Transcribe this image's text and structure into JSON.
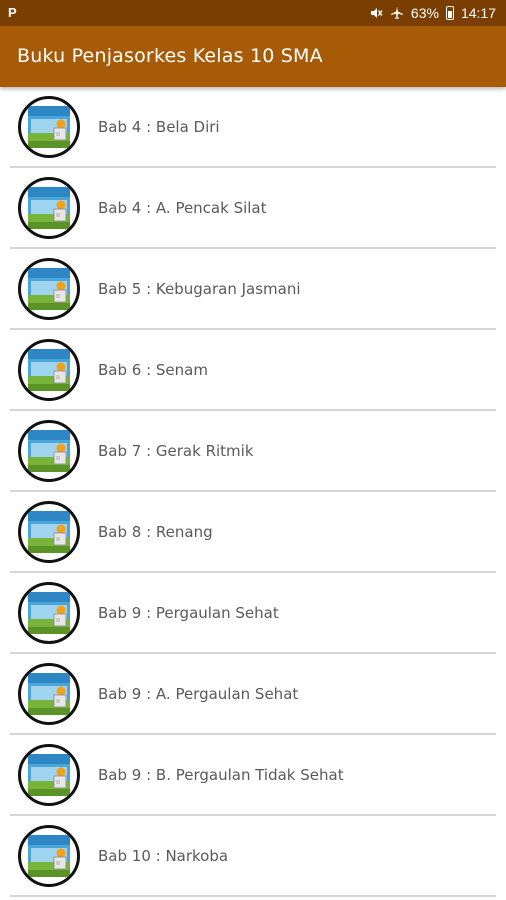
{
  "status_bar": {
    "battery": "63%",
    "time": "14:17"
  },
  "app_bar": {
    "title": "Buku Penjasorkes Kelas 10 SMA"
  },
  "chapters": [
    "Bab 4 : Bela Diri",
    "Bab 4 : A. Pencak Silat",
    "Bab 5 : Kebugaran Jasmani",
    "Bab 6 : Senam",
    "Bab 7 : Gerak Ritmik",
    "Bab 8 : Renang",
    "Bab 9 : Pergaulan Sehat",
    "Bab 9 : A. Pergaulan Sehat",
    "Bab 9 : B. Pergaulan Tidak Sehat",
    "Bab 10 : Narkoba"
  ]
}
